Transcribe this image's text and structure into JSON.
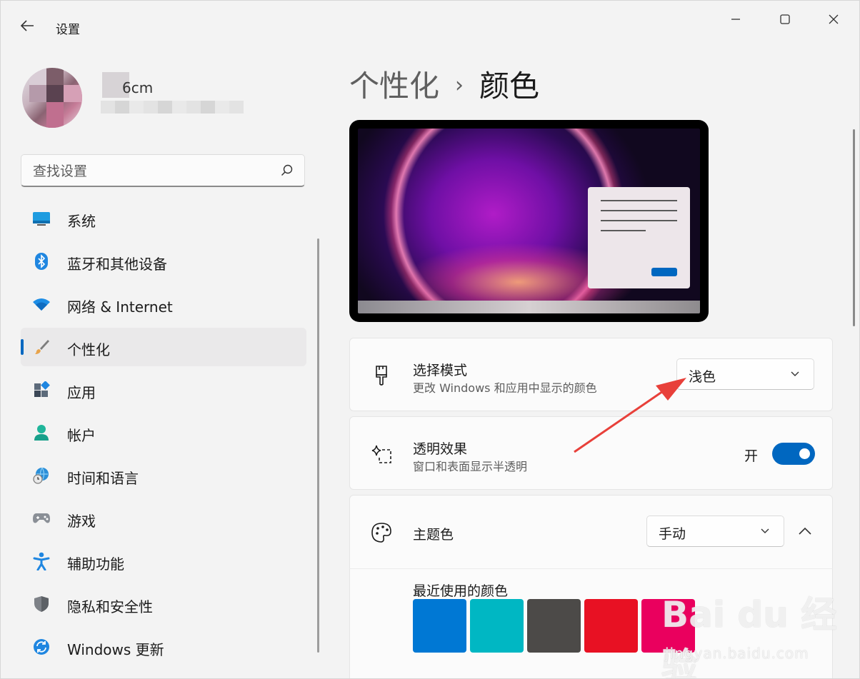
{
  "window": {
    "title": "设置",
    "back_icon": "←",
    "minimize_icon": "—",
    "maximize_icon": "☐",
    "close_icon": "✕"
  },
  "user": {
    "name_visible": "6cm"
  },
  "search": {
    "placeholder": "查找设置",
    "value": ""
  },
  "nav": {
    "items": [
      {
        "label": "系统",
        "icon": "system-icon"
      },
      {
        "label": "蓝牙和其他设备",
        "icon": "bluetooth-icon"
      },
      {
        "label": "网络 & Internet",
        "icon": "wifi-icon"
      },
      {
        "label": "个性化",
        "icon": "brush-icon",
        "selected": true
      },
      {
        "label": "应用",
        "icon": "apps-icon"
      },
      {
        "label": "帐户",
        "icon": "account-icon"
      },
      {
        "label": "时间和语言",
        "icon": "globe-clock-icon"
      },
      {
        "label": "游戏",
        "icon": "gamepad-icon"
      },
      {
        "label": "辅助功能",
        "icon": "accessibility-icon"
      },
      {
        "label": "隐私和安全性",
        "icon": "shield-icon"
      },
      {
        "label": "Windows 更新",
        "icon": "update-icon"
      }
    ]
  },
  "breadcrumb": {
    "parent": "个性化",
    "separator": "›",
    "current": "颜色"
  },
  "mode_card": {
    "title": "选择模式",
    "description": "更改 Windows 和应用中显示的颜色",
    "selected": "浅色"
  },
  "transparency_card": {
    "title": "透明效果",
    "description": "窗口和表面显示半透明",
    "state_label": "开",
    "on": true
  },
  "accent_card": {
    "title": "主题色",
    "selected": "手动",
    "recent_label": "最近使用的颜色",
    "recent_colors": [
      "#0078d4",
      "#00b7c3",
      "#4c4a48",
      "#e81123",
      "#ea005e"
    ]
  },
  "colors": {
    "accent": "#0067c0",
    "annotation_arrow": "#e8403a"
  },
  "watermark": {
    "brand": "Bai du 经验",
    "url": "jingyan.baidu.com"
  }
}
